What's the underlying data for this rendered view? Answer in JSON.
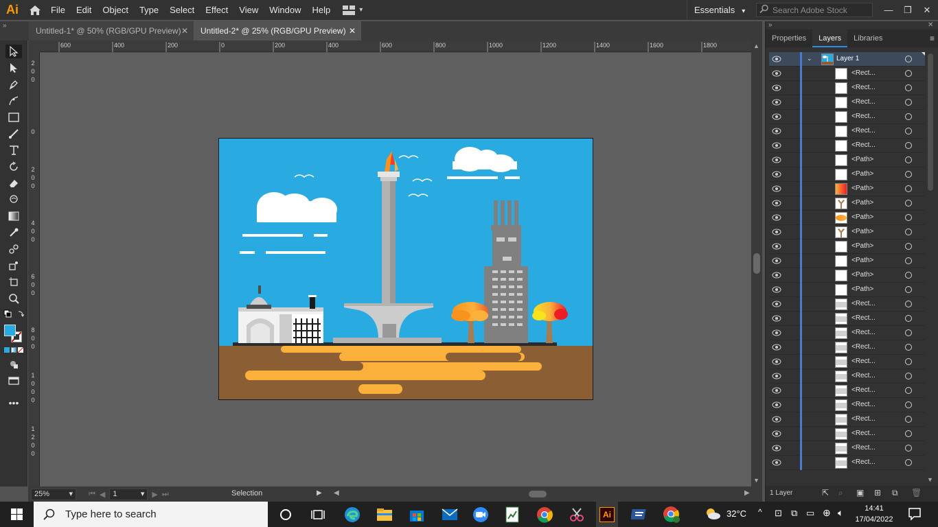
{
  "app": {
    "logo": "Ai",
    "menu": [
      "File",
      "Edit",
      "Object",
      "Type",
      "Select",
      "Effect",
      "View",
      "Window",
      "Help"
    ],
    "workspace": "Essentials",
    "stock_search_placeholder": "Search Adobe Stock"
  },
  "tabs": [
    {
      "label": "Untitled-1* @ 50% (RGB/GPU Preview)",
      "active": false
    },
    {
      "label": "Untitled-2* @ 25% (RGB/GPU Preview)",
      "active": true
    }
  ],
  "ruler": {
    "top": [
      "600",
      "400",
      "200",
      "0",
      "200",
      "400",
      "600",
      "800",
      "1000",
      "1200",
      "1400",
      "1600",
      "1800"
    ],
    "left": [
      "200",
      "0",
      "200",
      "400",
      "600",
      "800",
      "1000",
      "1200"
    ]
  },
  "status": {
    "zoom": "25%",
    "artboard": "1",
    "tool": "Selection"
  },
  "panel": {
    "tabs": [
      "Properties",
      "Layers",
      "Libraries"
    ],
    "active_tab": "Layers",
    "layer_name": "Layer 1",
    "footer": "1 Layer",
    "sublayers": [
      "<Rect...",
      "<Rect...",
      "<Rect...",
      "<Rect...",
      "<Rect...",
      "<Rect...",
      "<Path>",
      "<Path>",
      "<Path>",
      "<Path>",
      "<Path>",
      "<Path>",
      "<Path>",
      "<Path>",
      "<Path>",
      "<Path>",
      "<Rect...",
      "<Rect...",
      "<Rect...",
      "<Rect...",
      "<Rect...",
      "<Rect...",
      "<Rect...",
      "<Rect...",
      "<Rect...",
      "<Rect...",
      "<Rect...",
      "<Rect..."
    ]
  },
  "taskbar": {
    "search_placeholder": "Type here to search",
    "temperature": "32°C",
    "time": "14:41",
    "date": "17/04/2022"
  },
  "colors": {
    "sky": "#29abe2",
    "ground": "#8b5e34",
    "river": "#fbb03b",
    "accent": "#2b8de8"
  }
}
